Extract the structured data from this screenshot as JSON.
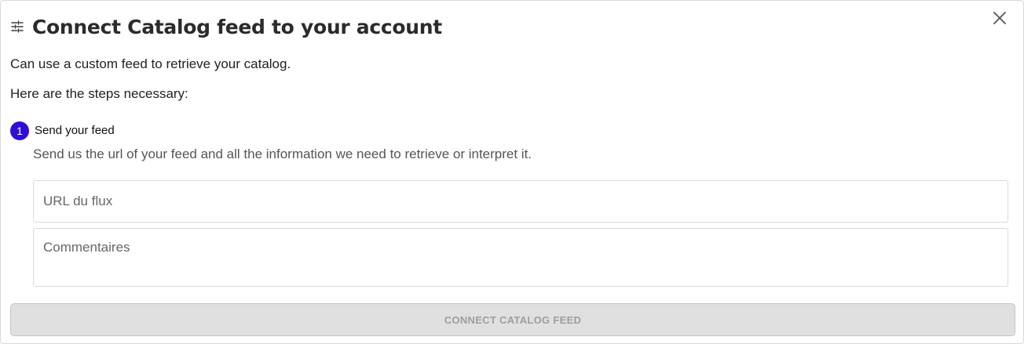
{
  "dialog": {
    "title": "Connect Catalog feed to your account",
    "title_icon": "filter-settings-icon",
    "close_icon": "close-icon",
    "intro_text": "Can use a custom feed to retrieve your catalog.",
    "steps_intro": "Here are the steps necessary:"
  },
  "step": {
    "number": "1",
    "title": "Send your feed",
    "description": "Send us the url of your feed and all the information we need to retrieve or interpret it.",
    "accent_color": "#2f0fd6"
  },
  "form": {
    "url_placeholder": "URL du flux",
    "url_value": "",
    "comments_placeholder": "Commentaires",
    "comments_value": "",
    "submit_label": "CONNECT CATALOG FEED",
    "submit_state": "disabled"
  }
}
